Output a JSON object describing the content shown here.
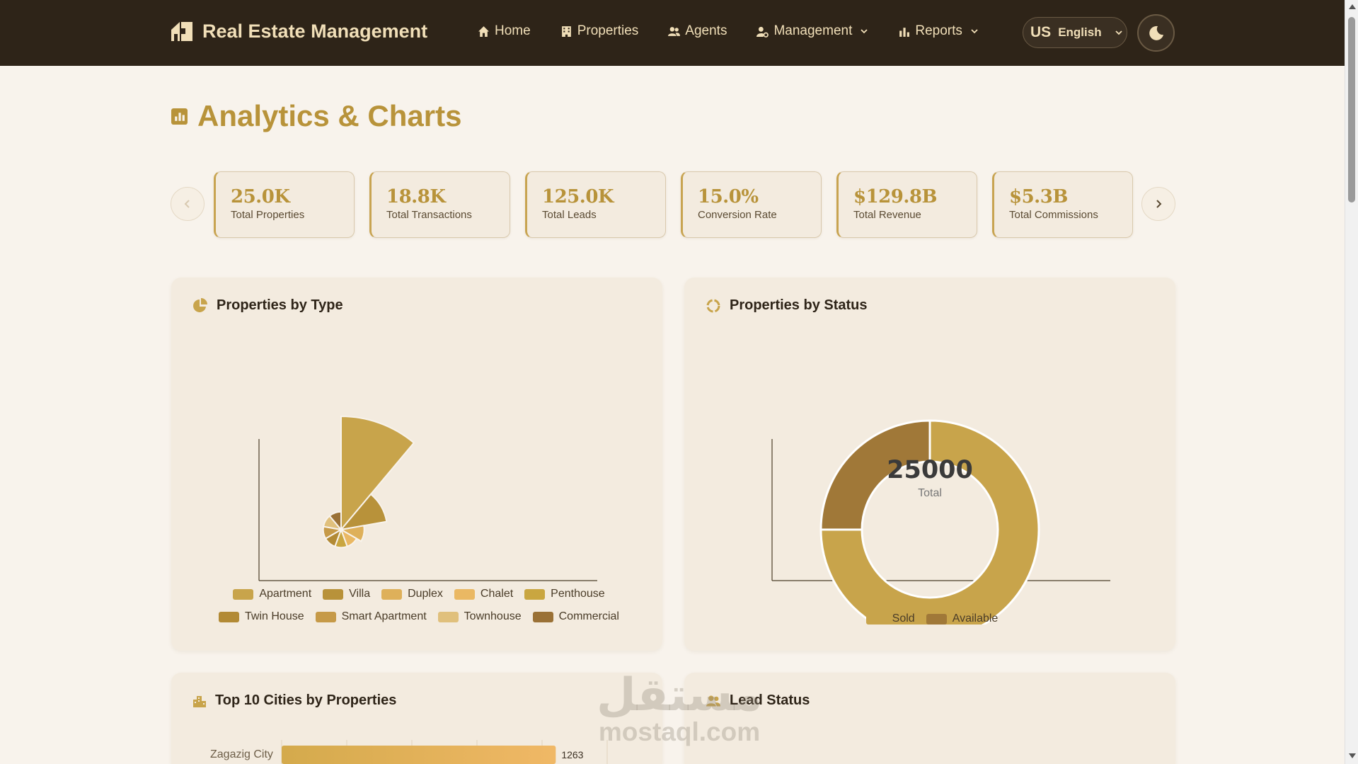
{
  "navbar": {
    "brand": "Real Estate Management",
    "items": [
      {
        "label": "Home",
        "icon": "home-icon"
      },
      {
        "label": "Properties",
        "icon": "building-icon"
      },
      {
        "label": "Agents",
        "icon": "users-icon"
      },
      {
        "label": "Management",
        "icon": "user-gear-icon",
        "dropdown": true
      },
      {
        "label": "Reports",
        "icon": "bar-chart-icon",
        "dropdown": true
      }
    ],
    "language": {
      "flag": "US",
      "label": "English"
    },
    "theme_toggle_icon": "moon-icon"
  },
  "page": {
    "title": "Analytics & Charts"
  },
  "kpis": [
    {
      "value": "25.0K",
      "label": "Total Properties"
    },
    {
      "value": "18.8K",
      "label": "Total Transactions"
    },
    {
      "value": "125.0K",
      "label": "Total Leads"
    },
    {
      "value": "15.0%",
      "label": "Conversion Rate"
    },
    {
      "value": "$129.8B",
      "label": "Total Revenue"
    },
    {
      "value": "$5.3B",
      "label": "Total Commissions"
    }
  ],
  "cards": {
    "by_type": {
      "title": "Properties by Type"
    },
    "by_status": {
      "title": "Properties by Status",
      "center_value": "25000",
      "center_label": "Total"
    },
    "top_cities": {
      "title": "Top 10 Cities by Properties"
    },
    "lead_status": {
      "title": "Lead Status"
    }
  },
  "chart_data": [
    {
      "type": "pie",
      "title": "Properties by Type",
      "categories": [
        "Apartment",
        "Villa",
        "Duplex",
        "Chalet",
        "Penthouse",
        "Twin House",
        "Smart Apartment",
        "Townhouse",
        "Commercial"
      ],
      "values": [
        12,
        2,
        0.5,
        0.3,
        0.3,
        0.3,
        0.3,
        0.3,
        0.3
      ],
      "colors": [
        "#c8a44b",
        "#b8923a",
        "#deb05a",
        "#eab863",
        "#c9a640",
        "#b28a35",
        "#c69a48",
        "#e0c07c",
        "#9a7136"
      ]
    },
    {
      "type": "pie",
      "title": "Properties by Status",
      "categories": [
        "Sold",
        "Available"
      ],
      "values": [
        18750,
        6250
      ],
      "colors": [
        "#c8a44b",
        "#a07838"
      ]
    },
    {
      "type": "bar",
      "title": "Top 10 Cities by Properties",
      "categories": [
        "Zagazig City"
      ],
      "values": [
        1263
      ]
    }
  ],
  "watermark": {
    "arabic": "مستقل",
    "latin": "mostaql.com"
  }
}
